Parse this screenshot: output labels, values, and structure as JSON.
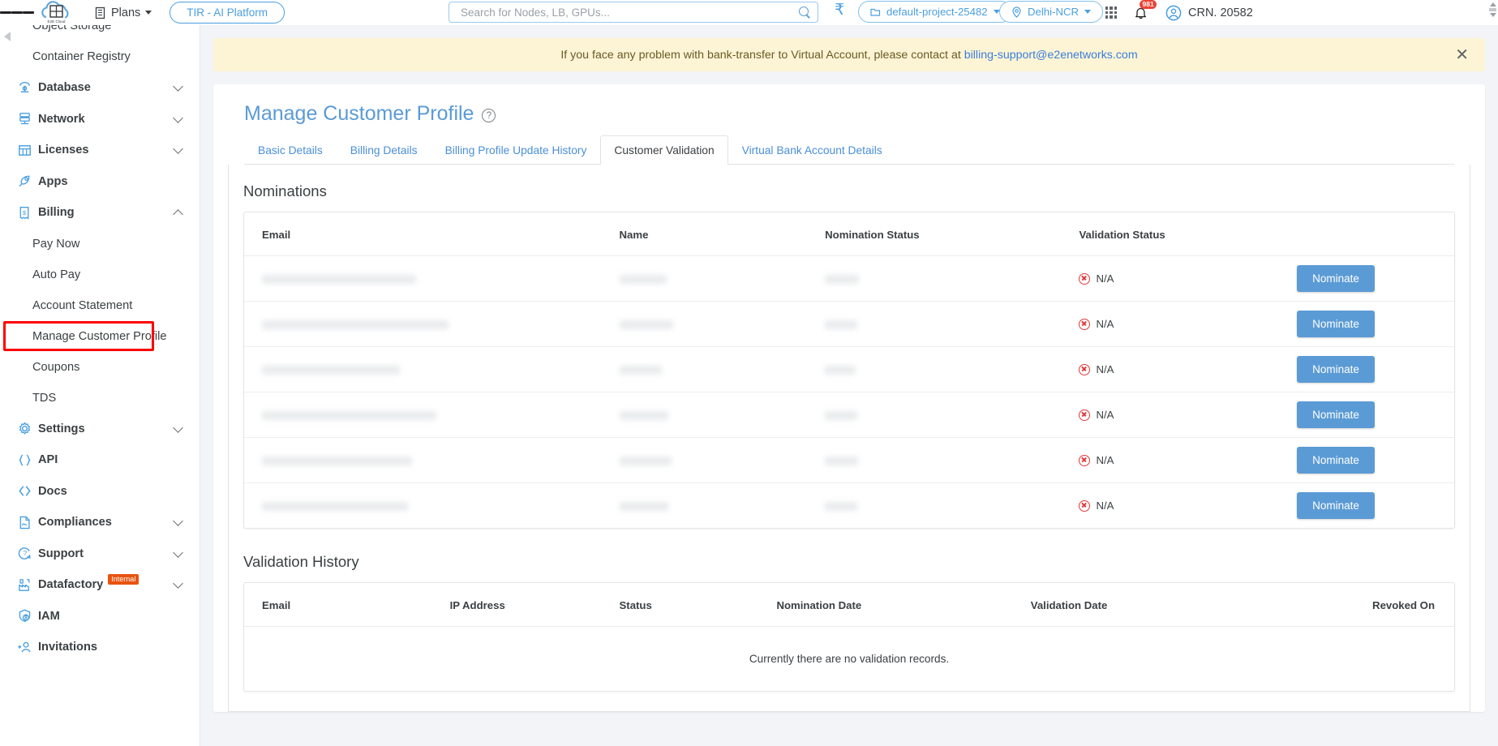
{
  "header": {
    "menu_icon": "hamburger-icon",
    "brand": "E2E Cloud",
    "plans_label": "Plans",
    "tir_label": "TIR - AI Platform",
    "search_placeholder": "Search for Nodes, LB, GPUs...",
    "search_value": "",
    "currency_symbol": "₹",
    "project_label": "default-project-25482",
    "region_label": "Delhi-NCR",
    "notification_count": "981",
    "user_label": "CRN. 20582"
  },
  "sidebar": {
    "items": [
      {
        "label": "Object Storage",
        "type": "sub",
        "icon": "",
        "expandable": false,
        "partial": true
      },
      {
        "label": "Container Registry",
        "type": "sub",
        "icon": "",
        "expandable": false
      },
      {
        "label": "Database",
        "type": "main",
        "icon": "database-icon",
        "expandable": true,
        "expanded": false
      },
      {
        "label": "Network",
        "type": "main",
        "icon": "network-icon",
        "expandable": true,
        "expanded": false
      },
      {
        "label": "Licenses",
        "type": "main",
        "icon": "licenses-icon",
        "expandable": true,
        "expanded": false
      },
      {
        "label": "Apps",
        "type": "main",
        "icon": "rocket-icon",
        "expandable": false
      },
      {
        "label": "Billing",
        "type": "main",
        "icon": "billing-icon",
        "expandable": true,
        "expanded": true
      },
      {
        "label": "Pay Now",
        "type": "sub",
        "icon": "",
        "expandable": false
      },
      {
        "label": "Auto Pay",
        "type": "sub",
        "icon": "",
        "expandable": false
      },
      {
        "label": "Account Statement",
        "type": "sub",
        "icon": "",
        "expandable": false
      },
      {
        "label": "Manage Customer Profile",
        "type": "sub",
        "icon": "",
        "expandable": false,
        "highlighted": true
      },
      {
        "label": "Coupons",
        "type": "sub",
        "icon": "",
        "expandable": false
      },
      {
        "label": "TDS",
        "type": "sub",
        "icon": "",
        "expandable": false
      },
      {
        "label": "Settings",
        "type": "main",
        "icon": "gear-icon",
        "expandable": true,
        "expanded": false
      },
      {
        "label": "API",
        "type": "main",
        "icon": "api-braces-icon",
        "expandable": false
      },
      {
        "label": "Docs",
        "type": "main",
        "icon": "docs-angle-icon",
        "expandable": false
      },
      {
        "label": "Compliances",
        "type": "main",
        "icon": "document-icon",
        "expandable": true,
        "expanded": false
      },
      {
        "label": "Support",
        "type": "main",
        "icon": "support-icon",
        "expandable": true,
        "expanded": false
      },
      {
        "label": "Datafactory",
        "type": "main",
        "icon": "factory-icon",
        "expandable": true,
        "expanded": false,
        "badge": "Internal"
      },
      {
        "label": "IAM",
        "type": "main",
        "icon": "shield-user-icon",
        "expandable": false
      },
      {
        "label": "Invitations",
        "type": "main",
        "icon": "add-user-icon",
        "expandable": false
      }
    ]
  },
  "alert": {
    "text_before": "If you face any problem with bank-transfer to Virtual Account, please contact at ",
    "link": "billing-support@e2enetworks.com",
    "close_icon": "close-icon"
  },
  "page": {
    "title": "Manage Customer Profile",
    "help_icon": "help-circle-icon"
  },
  "tabs": [
    {
      "label": "Basic Details",
      "active": false
    },
    {
      "label": "Billing Details",
      "active": false
    },
    {
      "label": "Billing Profile Update History",
      "active": false
    },
    {
      "label": "Customer Validation",
      "active": true,
      "highlighted": true
    },
    {
      "label": "Virtual Bank Account Details",
      "active": false
    }
  ],
  "nominations": {
    "title": "Nominations",
    "columns": [
      "Email",
      "Name",
      "Nomination Status",
      "Validation Status",
      ""
    ],
    "rows": [
      {
        "email": "",
        "name": "",
        "nomination_status": "",
        "validation_status": "N/A",
        "action": "Nominate",
        "redacted": true
      },
      {
        "email": "",
        "name": "",
        "nomination_status": "",
        "validation_status": "N/A",
        "action": "Nominate",
        "redacted": true
      },
      {
        "email": "",
        "name": "",
        "nomination_status": "",
        "validation_status": "N/A",
        "action": "Nominate",
        "redacted": true
      },
      {
        "email": "",
        "name": "",
        "nomination_status": "",
        "validation_status": "N/A",
        "action": "Nominate",
        "redacted": true
      },
      {
        "email": "",
        "name": "",
        "nomination_status": "",
        "validation_status": "N/A",
        "action": "Nominate",
        "redacted": true
      },
      {
        "email": "",
        "name": "",
        "nomination_status": "",
        "validation_status": "N/A",
        "action": "Nominate",
        "redacted": true
      }
    ]
  },
  "validation_history": {
    "title": "Validation History",
    "columns": [
      "Email",
      "IP Address",
      "Status",
      "Nomination Date",
      "Validation Date",
      "Revoked On"
    ],
    "empty_message": "Currently there are no validation records."
  },
  "colors": {
    "accent": "#5b9bd5",
    "link": "#3b7ddd",
    "alert_bg": "#fcf4d4",
    "highlight": "#ff0000",
    "danger": "#e03a3a",
    "badge": "#e8530e",
    "notification": "#ea4335"
  }
}
